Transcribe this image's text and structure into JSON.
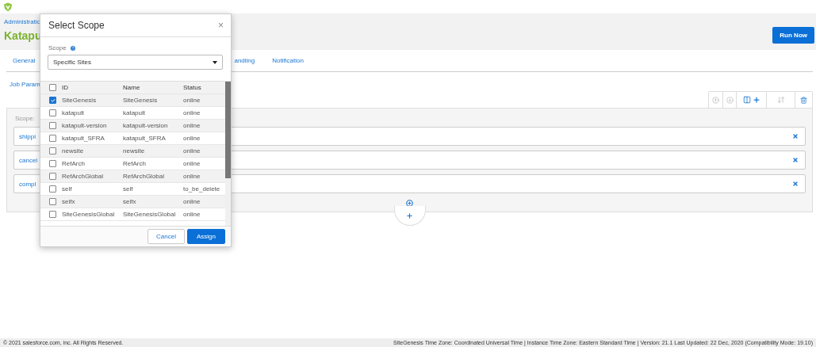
{
  "header": {
    "breadcrumb": "Administratio",
    "title": "Katapu",
    "run_button": "Run Now"
  },
  "tabs": [
    {
      "label": "General"
    },
    {
      "label": "andling"
    },
    {
      "label": "Notification"
    }
  ],
  "section_link": "Job Param",
  "toolbar": [
    {
      "kind": "move-up",
      "disabled": true
    },
    {
      "kind": "move-down",
      "disabled": true
    },
    {
      "kind": "add-column",
      "disabled": false
    },
    {
      "kind": "sort",
      "disabled": true
    },
    {
      "kind": "delete",
      "disabled": false
    }
  ],
  "flow": {
    "scope_label": "Scope:",
    "steps": [
      {
        "label": "shippi"
      },
      {
        "label": "cancel"
      },
      {
        "label": "compl"
      }
    ]
  },
  "modal": {
    "title": "Select Scope",
    "close": "×",
    "scope_label": "Scope",
    "scope_value": "Specific Sites",
    "columns": [
      "ID",
      "Name",
      "Status"
    ],
    "all_checked": false,
    "rows": [
      {
        "id": "SiteGenesis",
        "name": "SiteGenesis",
        "status": "online",
        "checked": true
      },
      {
        "id": "katapult",
        "name": "katapult",
        "status": "online",
        "checked": false
      },
      {
        "id": "katapult-version",
        "name": "katapult-version",
        "status": "online",
        "checked": false
      },
      {
        "id": "katapult_SFRA",
        "name": "katapult_SFRA",
        "status": "online",
        "checked": false
      },
      {
        "id": "newsite",
        "name": "newsite",
        "status": "online",
        "checked": false
      },
      {
        "id": "RefArch",
        "name": "RefArch",
        "status": "online",
        "checked": false
      },
      {
        "id": "RefArchGlobal",
        "name": "RefArchGlobal",
        "status": "online",
        "checked": false
      },
      {
        "id": "self",
        "name": "self",
        "status": "to_be_delete",
        "checked": false
      },
      {
        "id": "selfx",
        "name": "selfx",
        "status": "online",
        "checked": false
      },
      {
        "id": "SiteGenesisGlobal",
        "name": "SiteGenesisGlobal",
        "status": "online",
        "checked": false
      }
    ],
    "cancel": "Cancel",
    "assign": "Assign"
  },
  "footer": {
    "copyright": "© 2021 salesforce.com, inc. All Rights Reserved.",
    "info": "SiteGenesis Time Zone: Coordinated Universal Time | Instance Time Zone: Eastern Standard Time | Version: 21.1 Last Updated: 22 Dec, 2020 (Compatibility Mode: 19.10)"
  }
}
